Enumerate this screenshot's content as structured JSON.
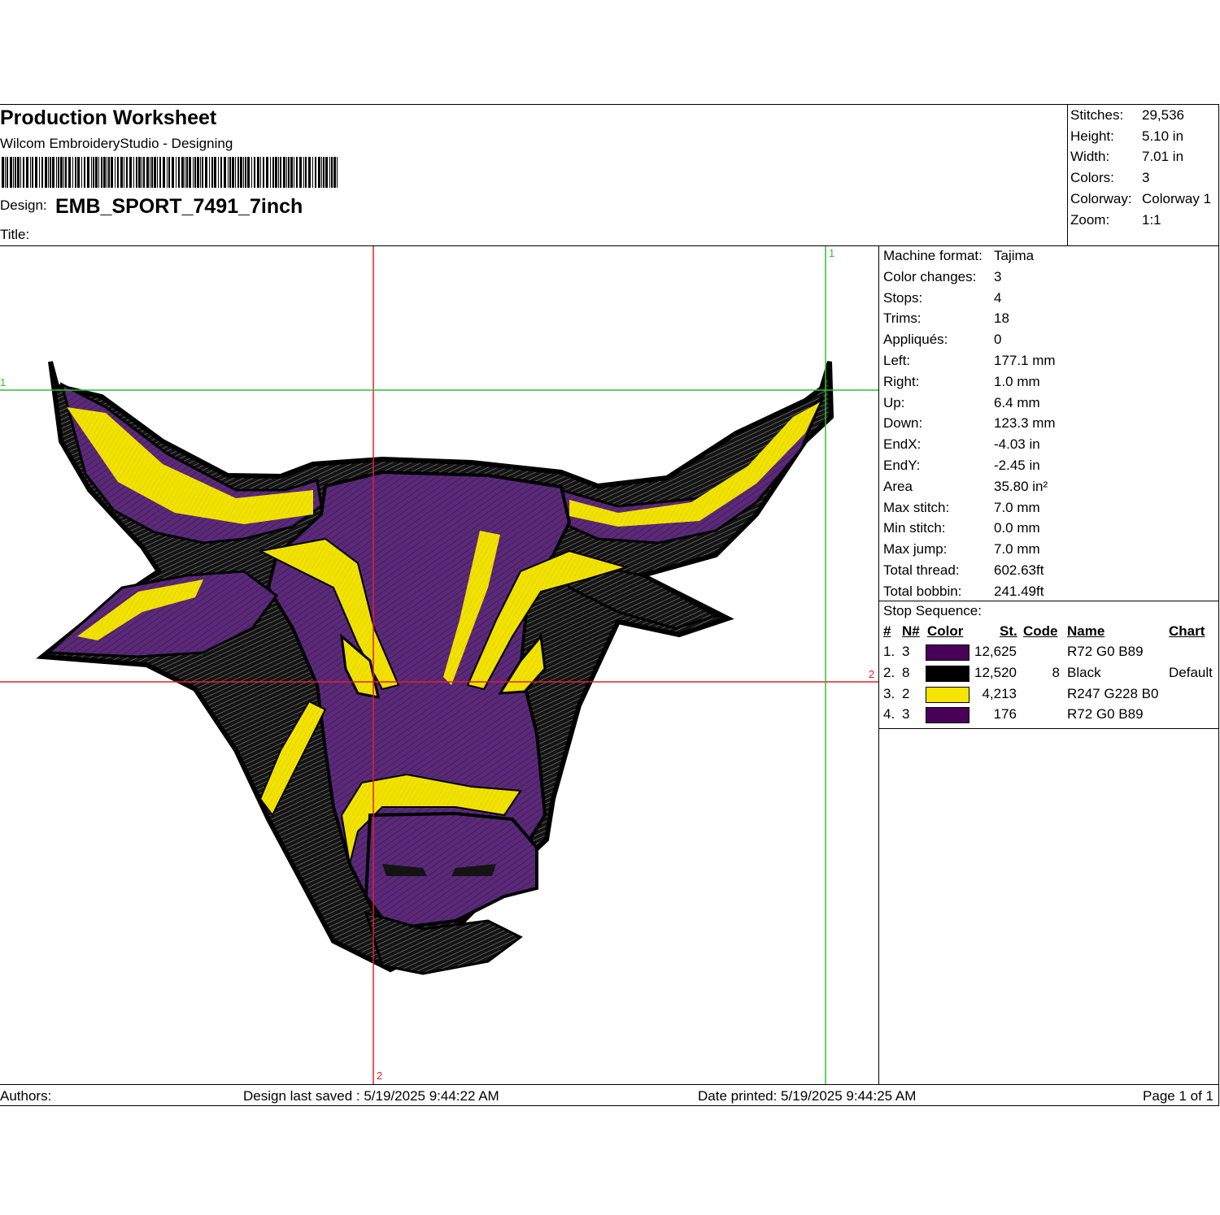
{
  "header": {
    "title": "Production Worksheet",
    "subtitle": "Wilcom EmbroideryStudio - Designing",
    "design_label": "Design:",
    "design_value": "EMB_SPORT_7491_7inch",
    "title_label": "Title:"
  },
  "summary": [
    {
      "label": "Stitches:",
      "value": "29,536"
    },
    {
      "label": "Height:",
      "value": "5.10 in"
    },
    {
      "label": "Width:",
      "value": "7.01 in"
    },
    {
      "label": "Colors:",
      "value": "3"
    },
    {
      "label": "Colorway:",
      "value": "Colorway 1"
    },
    {
      "label": "Zoom:",
      "value": "1:1"
    }
  ],
  "details": [
    {
      "label": "Machine format:",
      "value": "Tajima"
    },
    {
      "label": "Color changes:",
      "value": "3"
    },
    {
      "label": "Stops:",
      "value": "4"
    },
    {
      "label": "Trims:",
      "value": "18"
    },
    {
      "label": "Appliqués:",
      "value": "0"
    },
    {
      "label": "Left:",
      "value": "177.1 mm"
    },
    {
      "label": "Right:",
      "value": "1.0 mm"
    },
    {
      "label": "Up:",
      "value": "6.4 mm"
    },
    {
      "label": "Down:",
      "value": "123.3 mm"
    },
    {
      "label": "EndX:",
      "value": "-4.03 in"
    },
    {
      "label": "EndY:",
      "value": "-2.45 in"
    },
    {
      "label": "Area",
      "value": " 35.80 in²"
    },
    {
      "label": "Max stitch:",
      "value": "7.0 mm"
    },
    {
      "label": "Min stitch:",
      "value": "0.0 mm"
    },
    {
      "label": "Max jump:",
      "value": "7.0 mm"
    },
    {
      "label": "Total thread:",
      "value": "602.63ft"
    },
    {
      "label": "Total bobbin:",
      "value": "241.49ft"
    }
  ],
  "stop_sequence": {
    "title": "Stop Sequence:",
    "headers": {
      "num": "#",
      "needle": "N#",
      "color": "Color",
      "stitches": "St.",
      "code": "Code",
      "name": "Name",
      "chart": "Chart"
    },
    "rows": [
      {
        "num": "1.",
        "needle": "3",
        "swatch": "#480059",
        "stitches": "12,625",
        "code": "",
        "name": "R72 G0 B89",
        "chart": ""
      },
      {
        "num": "2.",
        "needle": "8",
        "swatch": "#000000",
        "stitches": "12,520",
        "code": "8",
        "name": "Black",
        "chart": "Default"
      },
      {
        "num": "3.",
        "needle": "2",
        "swatch": "#f7e400",
        "stitches": "4,213",
        "code": "",
        "name": "R247 G228 B0",
        "chart": ""
      },
      {
        "num": "4.",
        "needle": "3",
        "swatch": "#480059",
        "stitches": "176",
        "code": "",
        "name": "R72 G0 B89",
        "chart": ""
      }
    ]
  },
  "canvas": {
    "guide_labels": {
      "v_green": "1",
      "h_green": "1",
      "v_red": "2",
      "h_red": "2"
    },
    "colors": {
      "purple": "#5a2a78",
      "yellow": "#f2e200",
      "black": "#141414",
      "gray": "#8a8a8a",
      "red_guide": "#e0202a",
      "green_guide": "#2ec02e"
    }
  },
  "footer": {
    "authors": "Authors:",
    "saved": "Design last saved : 5/19/2025 9:44:22 AM",
    "printed": "Date printed: 5/19/2025 9:44:25 AM",
    "page": "Page 1 of 1"
  }
}
